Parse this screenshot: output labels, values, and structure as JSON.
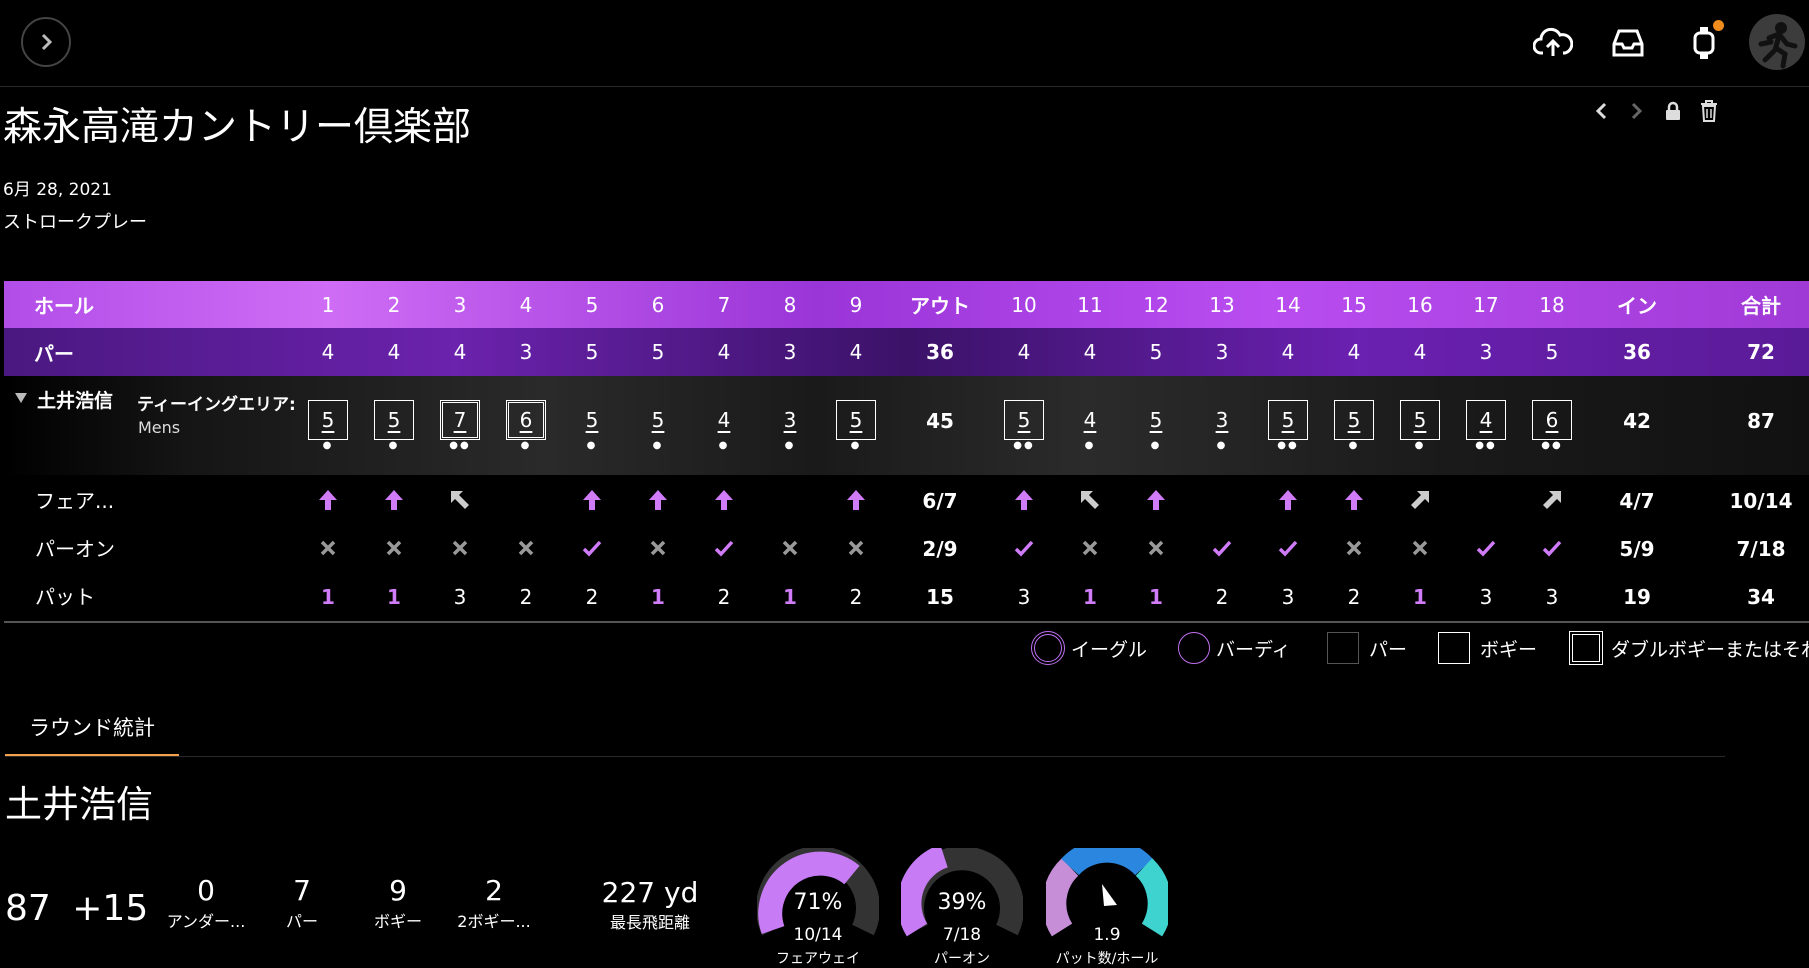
{
  "header": {
    "course_name": "森永高滝カントリー倶楽部",
    "date": "6月 28, 2021",
    "play_type": "ストロークプレー"
  },
  "scorecard": {
    "labels": {
      "hole": "ホール",
      "par": "パー",
      "out": "アウト",
      "in": "イン",
      "total": "合計",
      "fairway": "フェア...",
      "gir": "パーオン",
      "putts": "パット"
    },
    "holes": [
      "1",
      "2",
      "3",
      "4",
      "5",
      "6",
      "7",
      "8",
      "9",
      "10",
      "11",
      "12",
      "13",
      "14",
      "15",
      "16",
      "17",
      "18"
    ],
    "par": [
      "4",
      "4",
      "4",
      "3",
      "5",
      "5",
      "4",
      "3",
      "4",
      "4",
      "4",
      "5",
      "3",
      "4",
      "4",
      "4",
      "3",
      "5"
    ],
    "par_out": "36",
    "par_in": "36",
    "par_total": "72",
    "player": {
      "name": "土井浩信",
      "tee_label": "ティーイングエリア:",
      "tee_value": "Mens",
      "scores": [
        "5",
        "5",
        "7",
        "6",
        "5",
        "5",
        "4",
        "3",
        "5",
        "5",
        "4",
        "5",
        "3",
        "5",
        "5",
        "5",
        "4",
        "6"
      ],
      "score_out": "45",
      "score_in": "42",
      "score_total": "87"
    },
    "fairway": {
      "icons": [
        "arrow-up",
        "arrow-up",
        "arrow-up-left",
        "",
        "arrow-up",
        "arrow-up",
        "arrow-up",
        "",
        "arrow-up",
        "arrow-up",
        "arrow-up-left",
        "arrow-up",
        "",
        "arrow-up",
        "arrow-up",
        "arrow-up-right",
        "",
        "arrow-up-right"
      ],
      "out": "6/7",
      "in": "4/7",
      "total": "10/14"
    },
    "gir": {
      "icons": [
        "x",
        "x",
        "x",
        "x",
        "check",
        "x",
        "check",
        "x",
        "x",
        "check",
        "x",
        "x",
        "check",
        "check",
        "x",
        "x",
        "check",
        "check"
      ],
      "out": "2/9",
      "in": "5/9",
      "total": "7/18"
    },
    "putts": {
      "values": [
        "1",
        "1",
        "3",
        "2",
        "2",
        "1",
        "2",
        "1",
        "2",
        "3",
        "1",
        "1",
        "2",
        "3",
        "2",
        "1",
        "3",
        "3"
      ],
      "out": "15",
      "in": "19",
      "total": "34"
    }
  },
  "legend": {
    "eagle": "イーグル",
    "birdie": "バーディ",
    "par": "パー",
    "bogey": "ボギー",
    "double_bogey": "ダブルボギーまたはそれ"
  },
  "stats": {
    "tab_label": "ラウンド統計",
    "player_name": "土井浩信",
    "score": "87",
    "to_par": "+15",
    "under_par": {
      "value": "0",
      "label": "アンダー..."
    },
    "pars": {
      "value": "7",
      "label": "パー"
    },
    "bogeys": {
      "value": "9",
      "label": "ボギー"
    },
    "double_bogeys": {
      "value": "2",
      "label": "2ボギー..."
    },
    "longest_drive": {
      "value": "227 yd",
      "label": "最長飛距離"
    },
    "fairway_gauge": {
      "percent": "71%",
      "fraction": "10/14",
      "label": "フェアウェイ"
    },
    "gir_gauge": {
      "percent": "39%",
      "fraction": "7/18",
      "label": "パーオン"
    },
    "putts_gauge": {
      "value": "1.9",
      "label": "パット数/ホール"
    }
  },
  "colors": {
    "accent_purple": "#d07cf9",
    "tab_underline": "#f5a14c",
    "notification": "#f08c1e"
  }
}
